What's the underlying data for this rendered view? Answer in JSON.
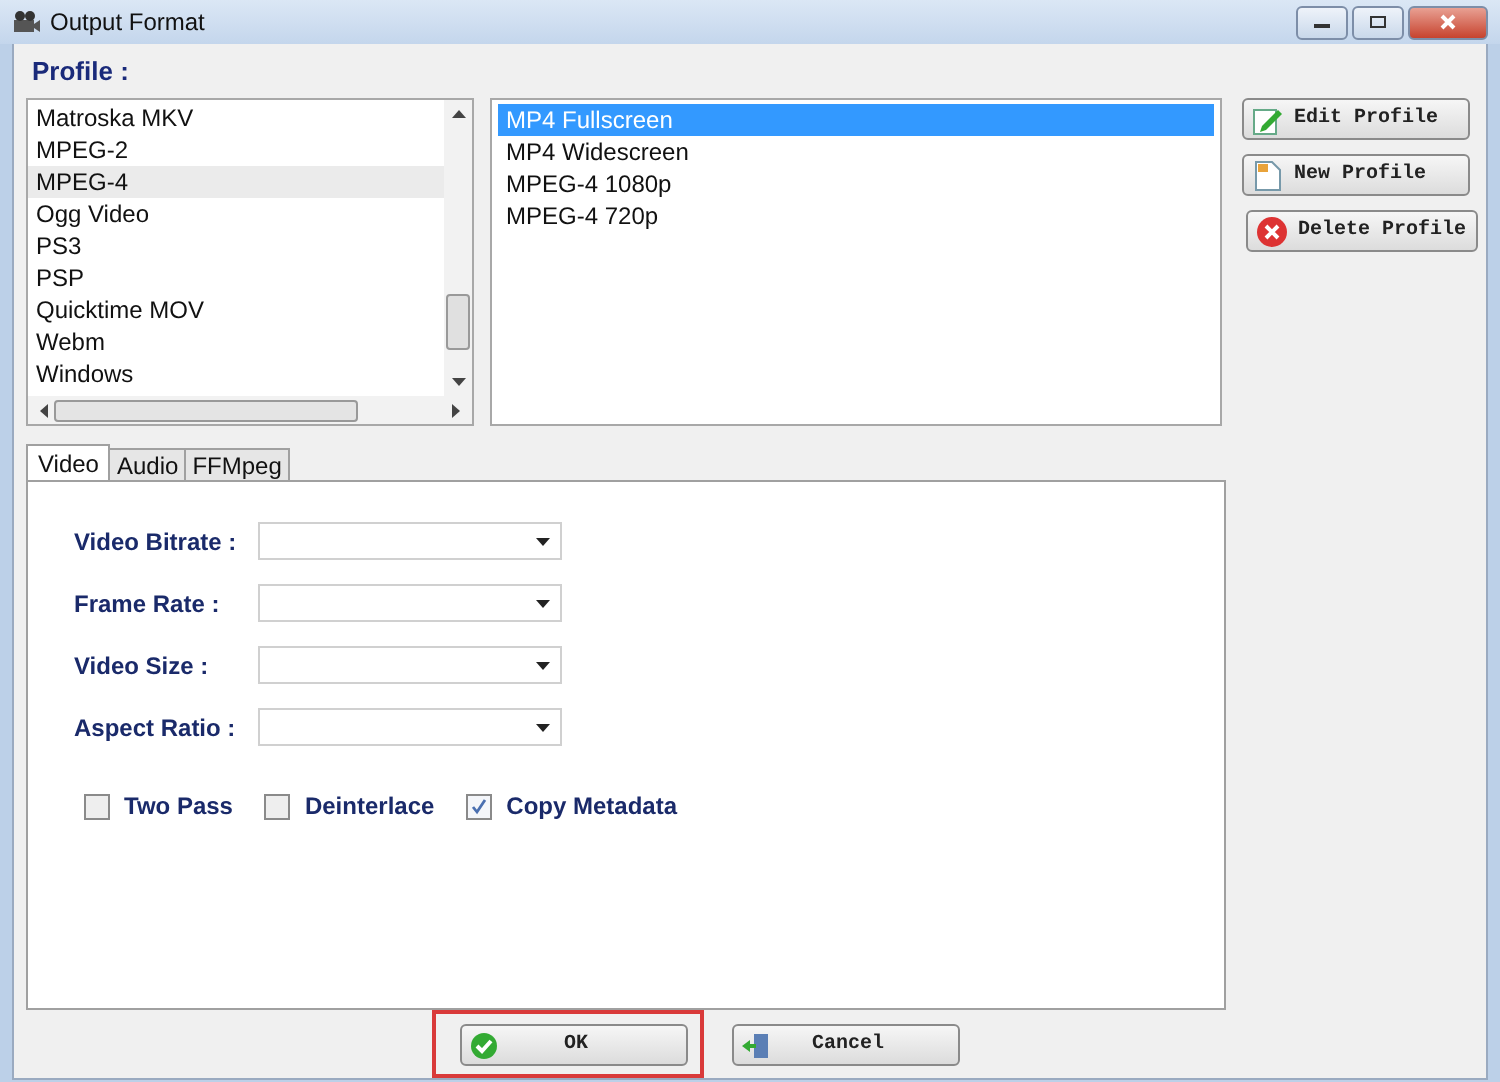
{
  "window": {
    "title": "Output Format"
  },
  "profile_label": "Profile :",
  "formats": [
    {
      "label": "Matroska MKV",
      "selected": false
    },
    {
      "label": "MPEG-2",
      "selected": false
    },
    {
      "label": "MPEG-4",
      "selected": true
    },
    {
      "label": "Ogg Video",
      "selected": false
    },
    {
      "label": "PS3",
      "selected": false
    },
    {
      "label": "PSP",
      "selected": false
    },
    {
      "label": "Quicktime MOV",
      "selected": false
    },
    {
      "label": "Webm",
      "selected": false
    },
    {
      "label": "Windows",
      "selected": false
    }
  ],
  "profiles": [
    {
      "label": "MP4 Fullscreen",
      "selected": true
    },
    {
      "label": "MP4 Widescreen",
      "selected": false
    },
    {
      "label": "MPEG-4 1080p",
      "selected": false
    },
    {
      "label": "MPEG-4 720p",
      "selected": false
    }
  ],
  "profile_buttons": [
    {
      "label": "Edit Profile",
      "kind": "edit"
    },
    {
      "label": "New Profile",
      "kind": "new"
    },
    {
      "label": "Delete Profile",
      "kind": "delete"
    }
  ],
  "tabs": [
    {
      "label": "Video",
      "selected": true
    },
    {
      "label": "Audio",
      "selected": false
    },
    {
      "label": "FFMpeg",
      "selected": false
    }
  ],
  "fields": [
    {
      "label": "Video Bitrate :"
    },
    {
      "label": "Frame Rate :"
    },
    {
      "label": "Video Size :"
    },
    {
      "label": "Aspect Ratio :"
    }
  ],
  "checkboxes": [
    {
      "label": "Two Pass",
      "checked": false
    },
    {
      "label": "Deinterlace",
      "checked": false
    },
    {
      "label": "Copy Metadata",
      "checked": true
    }
  ],
  "buttons": [
    {
      "label": "OK",
      "kind": "ok",
      "highlighted": true
    },
    {
      "label": "Cancel",
      "kind": "cancel",
      "highlighted": false
    }
  ]
}
